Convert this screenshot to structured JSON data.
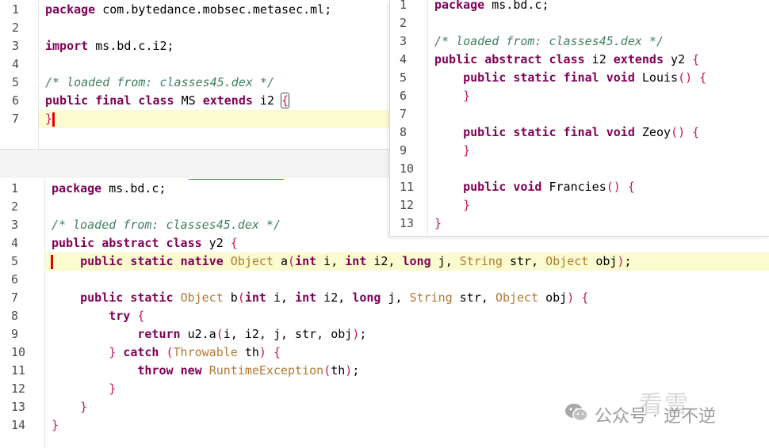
{
  "pane_top_left": {
    "lines": [
      {
        "n": "1",
        "code": "package com.bytedance.mobsec.metasec.ml;"
      },
      {
        "n": "2",
        "code": ""
      },
      {
        "n": "3",
        "code": "import ms.bd.c.i2;"
      },
      {
        "n": "4",
        "code": ""
      },
      {
        "n": "5",
        "code": "/* loaded from: classes45.dex */"
      },
      {
        "n": "6",
        "code": "public final class MS extends i2 {"
      },
      {
        "n": "7",
        "code": "}"
      }
    ]
  },
  "pane_right": {
    "lines": [
      {
        "n": "1",
        "code": "package ms.bd.c;"
      },
      {
        "n": "2",
        "code": ""
      },
      {
        "n": "3",
        "code": "/* loaded from: classes45.dex */"
      },
      {
        "n": "4",
        "code": "public abstract class i2 extends y2 {"
      },
      {
        "n": "5",
        "code": "    public static final void Louis() {"
      },
      {
        "n": "6",
        "code": "    }"
      },
      {
        "n": "7",
        "code": ""
      },
      {
        "n": "8",
        "code": "    public static final void Zeoy() {"
      },
      {
        "n": "9",
        "code": "    }"
      },
      {
        "n": "10",
        "code": ""
      },
      {
        "n": "11",
        "code": "    public void Francies() {"
      },
      {
        "n": "12",
        "code": "    }"
      },
      {
        "n": "13",
        "code": "}"
      }
    ]
  },
  "pane_bottom": {
    "lines": [
      {
        "n": "1",
        "code": "package ms.bd.c;"
      },
      {
        "n": "2",
        "code": ""
      },
      {
        "n": "3",
        "code": "/* loaded from: classes45.dex */"
      },
      {
        "n": "4",
        "code": "public abstract class y2 {"
      },
      {
        "n": "5",
        "code": "    public static native Object a(int i, int i2, long j, String str, Object obj);"
      },
      {
        "n": "6",
        "code": ""
      },
      {
        "n": "7",
        "code": "    public static Object b(int i, int i2, long j, String str, Object obj) {"
      },
      {
        "n": "8",
        "code": "        try {"
      },
      {
        "n": "9",
        "code": "            return u2.a(i, i2, j, str, obj);"
      },
      {
        "n": "10",
        "code": "        } catch (Throwable th) {"
      },
      {
        "n": "11",
        "code": "            throw new RuntimeException(th);"
      },
      {
        "n": "12",
        "code": "        }"
      },
      {
        "n": "13",
        "code": "    }"
      },
      {
        "n": "14",
        "code": "}"
      }
    ]
  },
  "watermark": {
    "icon": "wechat-icon",
    "text": "公众号 · 逆不逆",
    "faint": "看雪"
  }
}
